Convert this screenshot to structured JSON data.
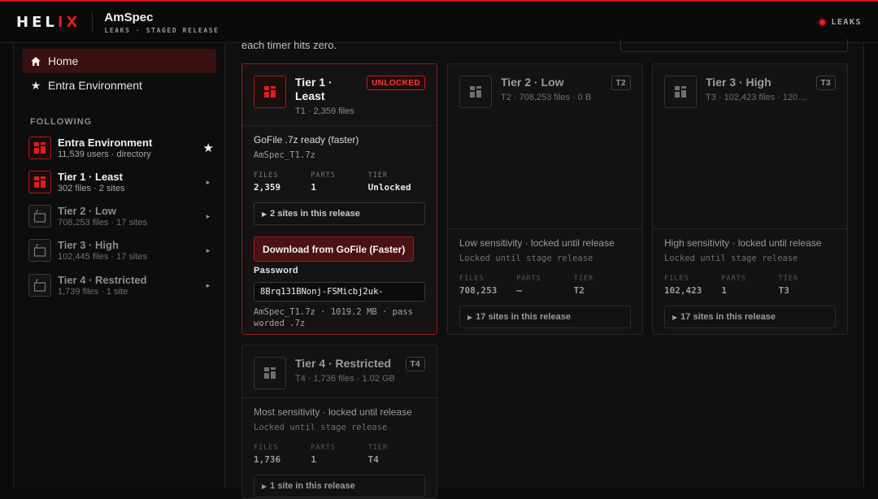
{
  "header": {
    "logo_a": "HEL",
    "logo_b": "IX",
    "app_title": "AmSpec",
    "app_subtitle": "LEAKS · STAGED RELEASE",
    "status_label": "LEAKS"
  },
  "sidebar": {
    "nav": [
      {
        "label": "Home",
        "icon": "home-icon"
      },
      {
        "label": "Entra Environment",
        "icon": "star-icon"
      }
    ],
    "following_label": "FOLLOWING",
    "following": [
      {
        "name": "Entra Environment",
        "sub": "11,539 users · directory",
        "tail": "★",
        "active": true
      },
      {
        "name": "Tier 1 · Least",
        "sub": "302 files · 2 sites",
        "tail": "▸",
        "active": true
      },
      {
        "name": "Tier 2 · Low",
        "sub": "708,253 files · 17 sites",
        "tail": "▸",
        "active": false
      },
      {
        "name": "Tier 3 · High",
        "sub": "102,445 files · 17 sites",
        "tail": "▸",
        "active": false
      },
      {
        "name": "Tier 4 · Restricted",
        "sub": "1,739 files · 1 site",
        "tail": "▸",
        "active": false
      }
    ]
  },
  "main": {
    "intro": "each timer hits zero."
  },
  "stat_labels": {
    "files": "FILES",
    "parts": "PARTS",
    "tier": "TIER"
  },
  "cards": [
    {
      "title_line1": "Tier 1 ·",
      "title_line2": "Least",
      "sub": "T1 · 2,359 files",
      "badge": "UNLOCKED",
      "desc": "GoFile .7z ready (faster)",
      "file": "AmSpec_T1.7z",
      "files": "2,359",
      "parts": "1",
      "tier": "Unlocked",
      "sites": "2 sites in this release",
      "download_label": "Download from GoFile (Faster)",
      "password_label": "Password",
      "password": "8Brq131BNonj-FSMicbj2uk-",
      "note": "AmSpec_T1.7z · 1019.2 MB · password protected · pass worded .7z",
      "note_line1": "AmSpec_T1.7z · 1019.2 MB · pass",
      "note_line2": "worded .7z"
    },
    {
      "title": "Tier 2 · Low",
      "sub": "T2 · 708,253 files · 0 B",
      "badge": "T2",
      "desc": "Low sensitivity · locked until release",
      "file": "Locked until stage release",
      "files": "708,253",
      "parts": "—",
      "tier": "T2",
      "sites": "17 sites in this release"
    },
    {
      "title": "Tier 3 · High",
      "sub": "T3 · 102,423 files · 120…",
      "badge": "T3",
      "desc": "High sensitivity · locked until release",
      "file": "Locked until stage release",
      "files": "102,423",
      "parts": "1",
      "tier": "T3",
      "sites": "17 sites in this release"
    },
    {
      "title": "Tier 4 · Restricted",
      "sub": "T4 · 1,736 files · 1.02 GB",
      "badge": "T4",
      "desc": "Most sensitivity · locked until release",
      "file": "Locked until stage release",
      "files": "1,736",
      "parts": "1",
      "tier": "T4",
      "sites": "1 site in this release"
    }
  ],
  "colors": {
    "accent": "#e01b1b",
    "accent_bg": "#3a1010",
    "bg": "#0b0b0c"
  }
}
